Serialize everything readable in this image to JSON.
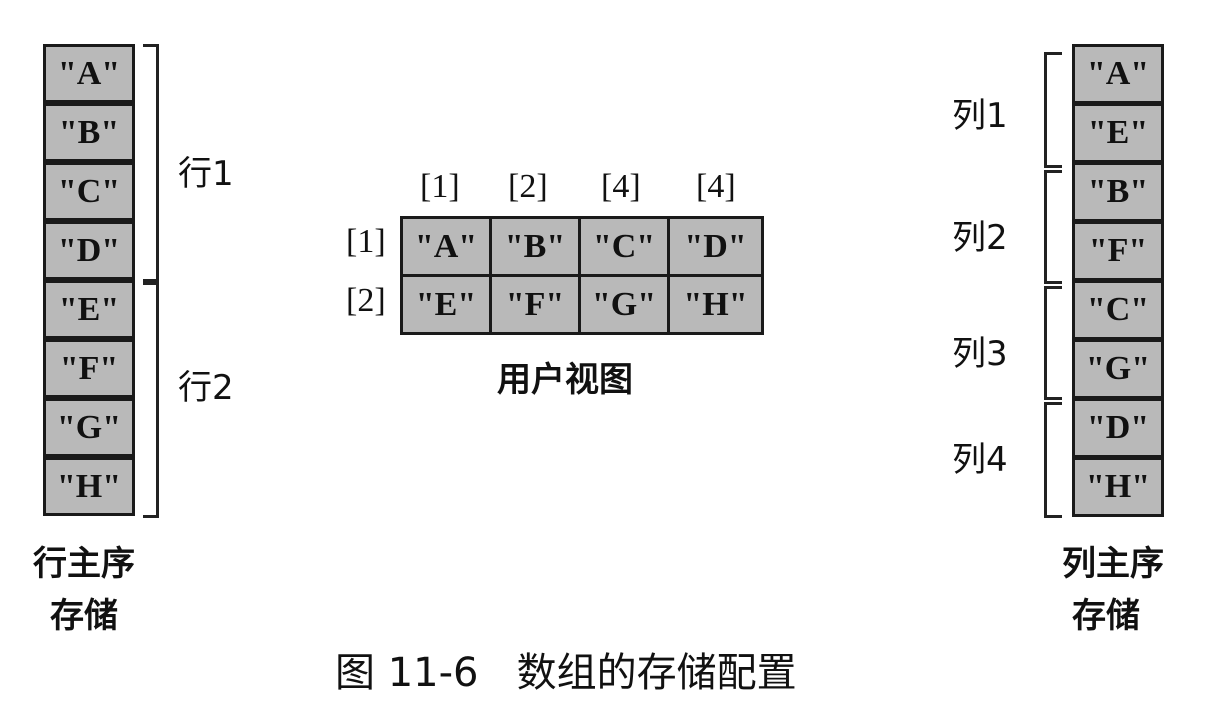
{
  "row_major": {
    "cells": [
      "\"A\"",
      "\"B\"",
      "\"C\"",
      "\"D\"",
      "\"E\"",
      "\"F\"",
      "\"G\"",
      "\"H\""
    ],
    "group_labels": [
      "行1",
      "行2"
    ],
    "caption_lines": [
      "行主序",
      "存储"
    ]
  },
  "user_view": {
    "column_headers": [
      "[1]",
      "[2]",
      "[4]",
      "[4]"
    ],
    "row_headers": [
      "[1]",
      "[2]"
    ],
    "rows": [
      [
        "\"A\"",
        "\"B\"",
        "\"C\"",
        "\"D\""
      ],
      [
        "\"E\"",
        "\"F\"",
        "\"G\"",
        "\"H\""
      ]
    ],
    "caption": "用户视图"
  },
  "column_major": {
    "cells": [
      "\"A\"",
      "\"E\"",
      "\"B\"",
      "\"F\"",
      "\"C\"",
      "\"G\"",
      "\"D\"",
      "\"H\""
    ],
    "group_labels": [
      "列1",
      "列2",
      "列3",
      "列4"
    ],
    "caption_lines": [
      "列主序",
      "存储"
    ]
  },
  "figure_caption": "图 11-6   数组的存储配置",
  "colors": {
    "cell_fill": "#b9b9b9",
    "border": "#1a1a1a"
  }
}
